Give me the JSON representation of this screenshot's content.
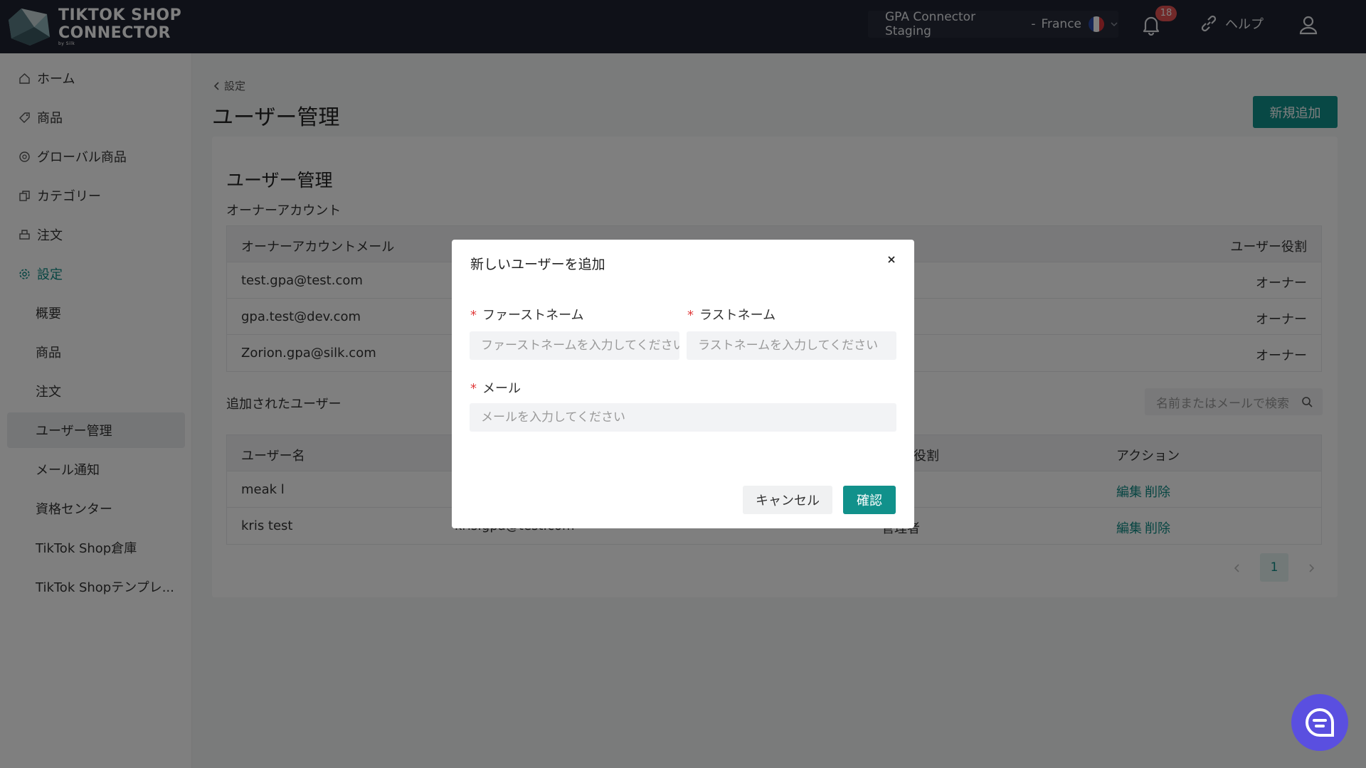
{
  "app": {
    "logo_line1": "TIKTOK SHOP",
    "logo_line2": "CONNECTOR",
    "logo_by": "by Silk",
    "store_name": "GPA Connector Staging",
    "store_sep": "-",
    "store_region": "France",
    "notification_count": "18",
    "help_label": "ヘルプ"
  },
  "sidebar": {
    "items": [
      {
        "label": "ホーム",
        "icon": "home-icon"
      },
      {
        "label": "商品",
        "icon": "tag-icon"
      },
      {
        "label": "グローバル商品",
        "icon": "globe-icon"
      },
      {
        "label": "カテゴリー",
        "icon": "copy-icon"
      },
      {
        "label": "注文",
        "icon": "printer-icon"
      },
      {
        "label": "設定",
        "icon": "gear-icon"
      }
    ],
    "sub_items": [
      "概要",
      "商品",
      "注文",
      "ユーザー管理",
      "メール通知",
      "資格センター",
      "TikTok Shop倉庫",
      "TikTok Shopテンプレ..."
    ]
  },
  "page": {
    "breadcrumb": "設定",
    "title": "ユーザー管理",
    "add_button": "新規追加",
    "card_title": "ユーザー管理",
    "owner_section": "オーナーアカウント",
    "owner_table": {
      "headers": [
        "オーナーアカウントメール",
        "ユーザー役割"
      ],
      "rows": [
        [
          "test.gpa@test.com",
          "オーナー"
        ],
        [
          "gpa.test@dev.com",
          "オーナー"
        ],
        [
          "Zorion.gpa@silk.com",
          "オーナー"
        ]
      ]
    },
    "added_section": "追加されたユーザー",
    "search_placeholder": "名前またはメールで検索",
    "users_table": {
      "headers": [
        "ユーザー名",
        "役割",
        "アクション"
      ],
      "rows": [
        {
          "name": "meak l",
          "email": "",
          "role": "",
          "edit": "編集",
          "delete": "削除"
        },
        {
          "name": "kris test",
          "email": "kris.gpa@test.com",
          "role": "管理者",
          "edit": "編集",
          "delete": "削除"
        }
      ]
    },
    "pagination": {
      "current": "1"
    }
  },
  "modal": {
    "title": "新しいユーザーを追加",
    "first_name_label": "ファーストネーム",
    "first_name_placeholder": "ファーストネームを入力してください",
    "last_name_label": "ラストネーム",
    "last_name_placeholder": "ラストネームを入力してください",
    "email_label": "メール",
    "email_placeholder": "メールを入力してください",
    "required_mark": "*",
    "cancel_label": "キャンセル",
    "confirm_label": "確認"
  },
  "colors": {
    "accent": "#11918b",
    "topbar": "#1f2330",
    "chat": "#5a4fe0"
  }
}
